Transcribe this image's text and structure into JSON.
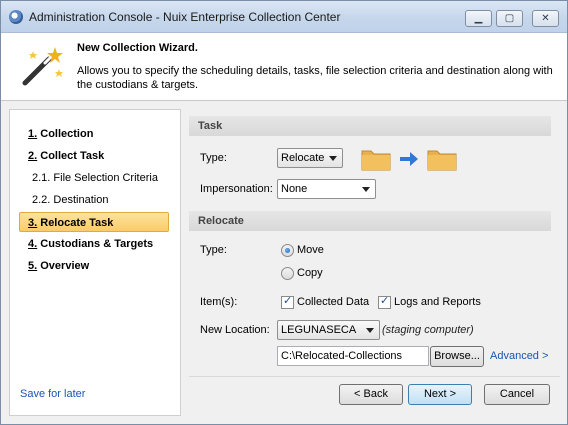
{
  "window": {
    "title": "Administration Console - Nuix Enterprise Collection Center",
    "minimize": "▁",
    "maximize": "▢",
    "close": "✕"
  },
  "header": {
    "title": "New Collection Wizard.",
    "description": "Allows you to specify the scheduling details, tasks, file selection criteria and destination along with the custodians & targets.",
    "icon": "magic-wand-icon"
  },
  "nav": {
    "items": [
      {
        "num": "1.",
        "label": "Collection"
      },
      {
        "num": "2.",
        "label": "Collect Task"
      },
      {
        "label": "2.1. File Selection Criteria"
      },
      {
        "label": "2.2. Destination"
      },
      {
        "num": "3.",
        "label": "Relocate Task"
      },
      {
        "num": "4.",
        "label": "Custodians & Targets"
      },
      {
        "num": "5.",
        "label": "Overview"
      }
    ],
    "save_later": "Save for later"
  },
  "task": {
    "header": "Task",
    "type_label": "Type:",
    "type_value": "Relocate",
    "impersonation_label": "Impersonation:",
    "impersonation_value": "None"
  },
  "relocate": {
    "header": "Relocate",
    "type_label": "Type:",
    "move_label": "Move",
    "copy_label": "Copy",
    "move_selected": true,
    "items_label": "Item(s):",
    "collected_data_label": "Collected Data",
    "logs_reports_label": "Logs and Reports",
    "new_location_label": "New Location:",
    "location_value": "LEGUNASECA",
    "location_hint": "(staging computer)",
    "path_value": "C:\\Relocated-Collections",
    "browse_label": "Browse...",
    "advanced_label": "Advanced >"
  },
  "footer": {
    "back_label": "< Back",
    "next_label": "Next >",
    "cancel_label": "Cancel"
  },
  "colors": {
    "accent": "#fbcb6a",
    "link": "#1a55b3",
    "folder": "#e8b04e",
    "arrow": "#2f7ad0"
  }
}
